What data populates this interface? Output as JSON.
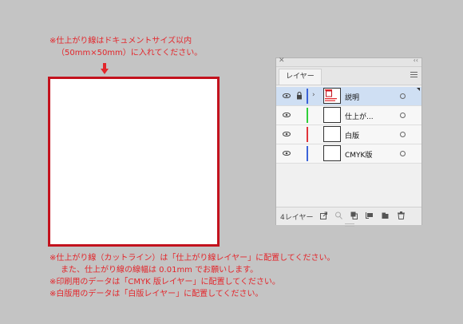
{
  "notes": {
    "top_line1": "※仕上がり線はドキュメントサイズ以内",
    "top_line2": "（50mm×50mm）に入れてください。",
    "bottom_line1": "※仕上がり線（カットライン）は「仕上がり線レイヤー」に配置してください。",
    "bottom_line2": "また、仕上がり線の線幅は 0.01mm でお願いします。",
    "bottom_line3": "※印刷用のデータは「CMYK 版レイヤー」に配置してください。",
    "bottom_line4": "※白版用のデータは「白版レイヤー」に配置してください。"
  },
  "panel": {
    "tab_label": "レイヤー",
    "layer_count": "4レイヤー",
    "layers": [
      {
        "name": "説明",
        "color": "#3b63d8",
        "selected": true,
        "locked": true,
        "expandable": true
      },
      {
        "name": "仕上が...",
        "color": "#2fcf3a",
        "selected": false,
        "locked": false,
        "expandable": false
      },
      {
        "name": "白版",
        "color": "#e0343a",
        "selected": false,
        "locked": false,
        "expandable": false
      },
      {
        "name": "CMYK版",
        "color": "#3b63d8",
        "selected": false,
        "locked": false,
        "expandable": false
      }
    ],
    "bottom_icons": [
      "export-icon",
      "locate-icon",
      "clipping-mask-icon",
      "new-sublayer-icon",
      "new-layer-icon",
      "trash-icon"
    ]
  },
  "colors": {
    "background": "#c4c4c4",
    "note_red": "#e3262b",
    "artboard_border": "#c3121d"
  }
}
